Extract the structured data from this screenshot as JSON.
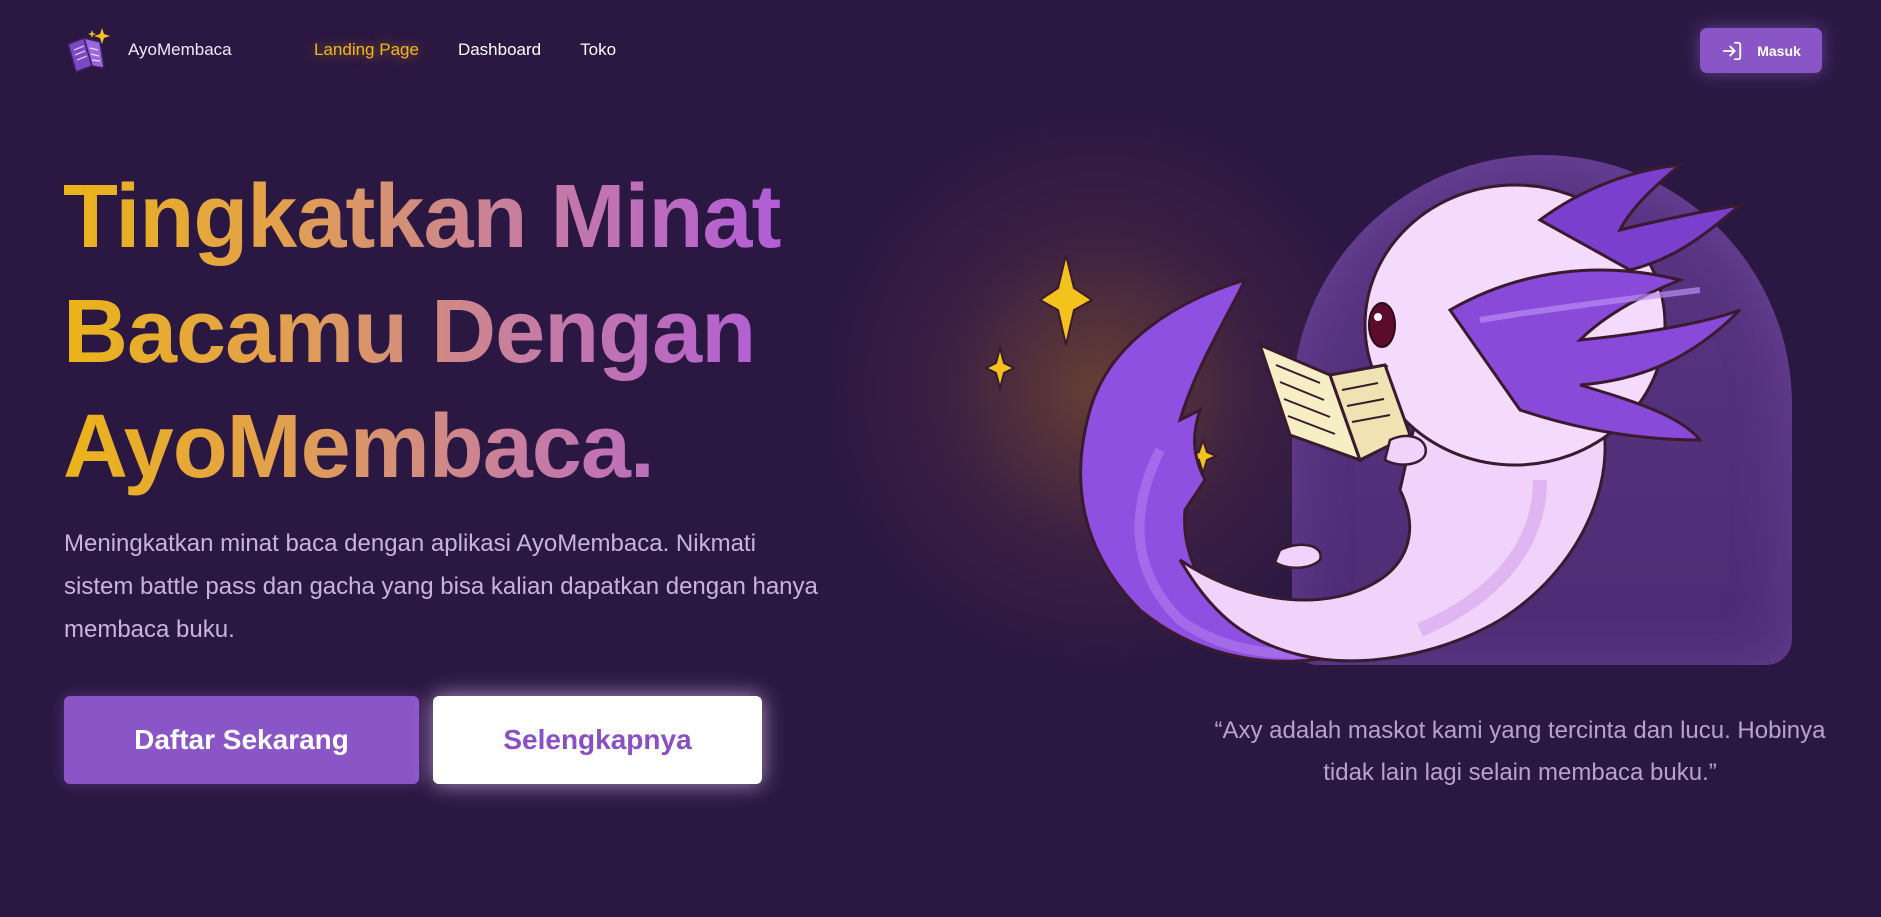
{
  "brand": {
    "name": "AyoMembaca",
    "logo_icon": "book-sparkle-icon"
  },
  "nav": {
    "links": [
      {
        "label": "Landing Page",
        "active": true
      },
      {
        "label": "Dashboard",
        "active": false
      },
      {
        "label": "Toko",
        "active": false
      }
    ],
    "login_label": "Masuk",
    "login_icon": "login-icon"
  },
  "hero": {
    "headline_lines": [
      "Tingkatkan Minat",
      "Bacamu Dengan",
      "AyoMembaca."
    ],
    "description": "Meningkatkan minat baca dengan aplikasi AyoMembaca. Nikmati sistem battle pass dan gacha yang bisa kalian dapatkan dengan hanya membaca buku.",
    "primary_button": "Daftar Sekarang",
    "secondary_button": "Selengkapnya"
  },
  "mascot": {
    "icon": "axolotl-mascot-icon",
    "quote": "“Axy adalah maskot kami yang tercinta dan lucu. Hobinya tidak lain lagi selain membaca buku.”"
  },
  "colors": {
    "background": "#2b1842",
    "accent": "#8a55c7",
    "active_nav": "#f2b618",
    "headline_gradient_start": "#eab418",
    "headline_gradient_end": "#b15cd9"
  }
}
